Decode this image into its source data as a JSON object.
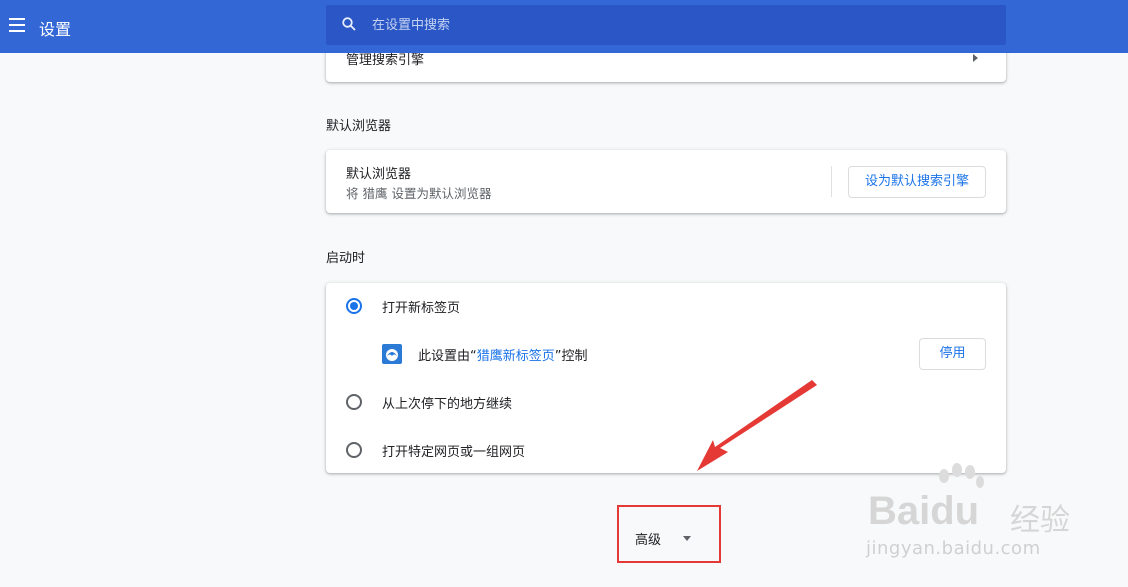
{
  "header": {
    "title": "设置",
    "search_placeholder": "在设置中搜索"
  },
  "search_engine": {
    "manage_label": "管理搜索引擎"
  },
  "default_browser": {
    "section_title": "默认浏览器",
    "row_title": "默认浏览器",
    "row_subtitle": "将 猎鹰 设置为默认浏览器",
    "button_label": "设为默认搜索引擎"
  },
  "startup": {
    "section_title": "启动时",
    "options": [
      {
        "label": "打开新标签页",
        "checked": true
      },
      {
        "label": "从上次停下的地方继续",
        "checked": false
      },
      {
        "label": "打开特定网页或一组网页",
        "checked": false
      }
    ],
    "extension_notice": {
      "prefix": "此设置由“",
      "extension_name": "猎鹰新标签页",
      "suffix": "”控制",
      "disable_button": "停用"
    }
  },
  "advanced": {
    "label": "高级"
  },
  "watermark": {
    "brand": "Baidu",
    "brand_cn": "经验",
    "domain": "jingyan.baidu.com"
  },
  "colors": {
    "header_bg": "#3367d6",
    "search_bg": "#2a56c6",
    "accent": "#1a73e8",
    "highlight_box": "#e53935",
    "arrow": "#e53935"
  }
}
